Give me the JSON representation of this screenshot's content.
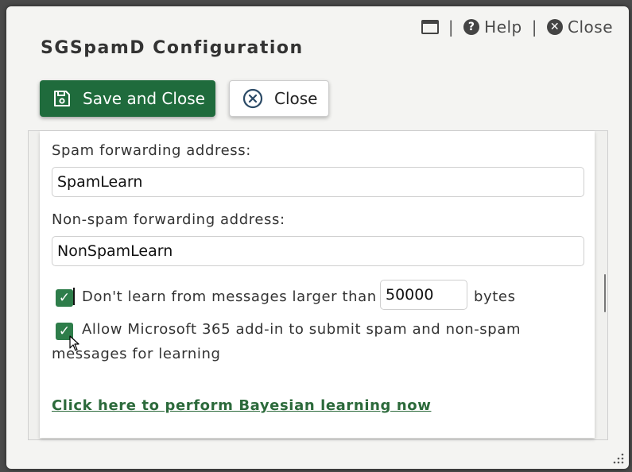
{
  "window": {
    "title": "SGSpamD Configuration"
  },
  "top_links": {
    "help_label": "Help",
    "close_label": "Close",
    "separator": "|"
  },
  "toolbar": {
    "save_label": "Save and Close",
    "close_label": "Close"
  },
  "form": {
    "spam_label": "Spam forwarding address:",
    "spam_value": "SpamLearn",
    "nonspam_label": "Non-spam forwarding address:",
    "nonspam_value": "NonSpamLearn",
    "size_limit": {
      "checked": true,
      "label_before": "Don't learn from messages larger than",
      "value": "50000",
      "label_after": "bytes"
    },
    "m365": {
      "checked": true,
      "label_line1": "Allow Microsoft 365 add-in to submit spam and non-spam",
      "label_line2": "messages for learning"
    },
    "learn_link": "Click here to perform Bayesian learning now"
  },
  "icons": {
    "window": "window-icon",
    "help": "question-circle-icon",
    "close": "x-circle-icon",
    "save": "floppy-disk-icon",
    "toolbar_close": "x-circle-outline-icon",
    "check": "checkmark-icon"
  },
  "colors": {
    "primary": "#1f6b3c",
    "checkbox": "#2e7d4a",
    "link": "#2c6a3b"
  }
}
